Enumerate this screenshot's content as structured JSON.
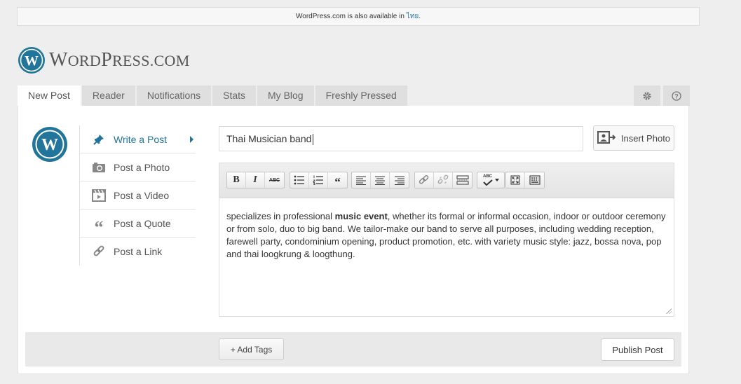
{
  "notice": {
    "text": "WordPress.com is also available in",
    "link": "ไทย",
    "end": "."
  },
  "logo": {
    "first": "W",
    "rest": "ORD",
    "second": "P",
    "rest2": "RESS",
    "suffix": ".COM"
  },
  "tabs": [
    {
      "label": "New Post",
      "active": true
    },
    {
      "label": "Reader"
    },
    {
      "label": "Notifications"
    },
    {
      "label": "Stats"
    },
    {
      "label": "My Blog"
    },
    {
      "label": "Freshly Pressed"
    }
  ],
  "tab_icons": {
    "settings": "gear-icon",
    "help": "question-icon"
  },
  "post_types": [
    {
      "label": "Write a Post",
      "icon": "pin-icon",
      "active": true
    },
    {
      "label": "Post a Photo",
      "icon": "camera-icon"
    },
    {
      "label": "Post a Video",
      "icon": "film-icon"
    },
    {
      "label": "Post a Quote",
      "icon": "quote-icon"
    },
    {
      "label": "Post a Link",
      "icon": "link-icon"
    }
  ],
  "title_value": "Thai Musician band",
  "insert_photo": "Insert Photo",
  "toolbar": {
    "bold": "B",
    "italic": "I",
    "strike": "ABC",
    "quote": "“",
    "spell": "ABC"
  },
  "content": {
    "before": "specializes in professional ",
    "bold": "music event",
    "after": ", whether its formal or informal occasion, indoor or outdoor ceremony or from solo, duo to big band. We tailor-make our band to serve all purposes, including wedding reception, farewell party, condominium opening, product promotion, etc. with variety music style: jazz, bossa nova, pop and thai loogkrung & loogthung."
  },
  "add_tags": "+ Add Tags",
  "publish": "Publish Post",
  "colors": {
    "accent": "#21759b",
    "background": "#eeeeee"
  }
}
